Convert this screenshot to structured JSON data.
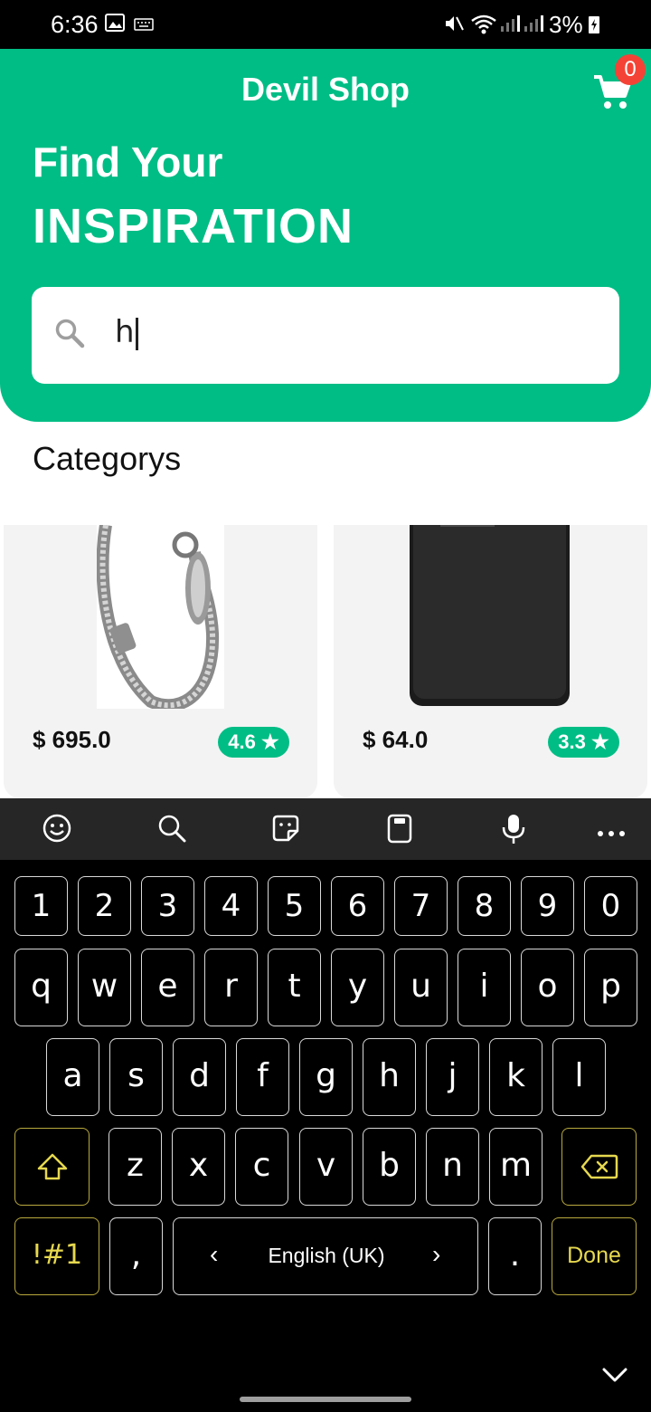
{
  "status_bar": {
    "time": "6:36",
    "battery": "3%"
  },
  "header": {
    "title": "Devil Shop",
    "cart_count": "0",
    "headline_line1": "Find Your",
    "headline_line2": "INSPIRATION"
  },
  "search": {
    "value": "h"
  },
  "categories_title": "Categorys",
  "products": [
    {
      "price": "$ 695.0",
      "rating": "4.6 ★"
    },
    {
      "price": "$ 64.0",
      "rating": "3.3 ★"
    }
  ],
  "keyboard": {
    "toolbar": [
      "emoji-icon",
      "search-icon",
      "sticker-icon",
      "clipboard-icon",
      "microphone-icon",
      "more-icon"
    ],
    "row_numbers": [
      "1",
      "2",
      "3",
      "4",
      "5",
      "6",
      "7",
      "8",
      "9",
      "0"
    ],
    "row1": [
      "q",
      "w",
      "e",
      "r",
      "t",
      "y",
      "u",
      "i",
      "o",
      "p"
    ],
    "row2": [
      "a",
      "s",
      "d",
      "f",
      "g",
      "h",
      "j",
      "k",
      "l"
    ],
    "row3": [
      "z",
      "x",
      "c",
      "v",
      "b",
      "n",
      "m"
    ],
    "symbols_label": "!#1",
    "comma": ",",
    "language": "English (UK)",
    "lang_prev": "‹",
    "lang_next": "›",
    "period": ".",
    "done_label": "Done"
  },
  "colors": {
    "accent": "#00BD85",
    "badge": "#F44336",
    "keyboard_bg": "#000000",
    "special_key": "#E6D84F"
  }
}
